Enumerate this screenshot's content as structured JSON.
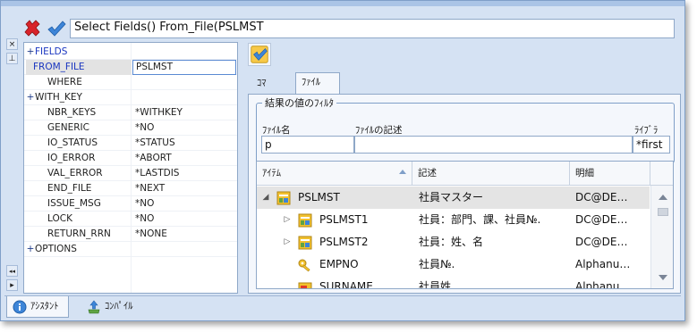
{
  "command": {
    "expression": "Select Fields() From_File(PSLMST"
  },
  "side_strip": {
    "close_glyph": "×",
    "pin_glyph": "⊥",
    "collapse_glyph": "◂◂",
    "expand_glyph": "▸"
  },
  "properties": [
    {
      "expander": "+",
      "name": "FIELDS",
      "value": "",
      "style": "blue"
    },
    {
      "expander": "+",
      "name": "FROM_FILE",
      "value": "PSLMST",
      "style": "blue-selected"
    },
    {
      "expander": "",
      "name": "WHERE",
      "value": "",
      "style": ""
    },
    {
      "expander": "+",
      "name": "WITH_KEY",
      "value": "",
      "style": ""
    },
    {
      "expander": "",
      "name": "NBR_KEYS",
      "value": "*WITHKEY",
      "style": ""
    },
    {
      "expander": "",
      "name": "GENERIC",
      "value": "*NO",
      "style": ""
    },
    {
      "expander": "",
      "name": "IO_STATUS",
      "value": "*STATUS",
      "style": ""
    },
    {
      "expander": "",
      "name": "IO_ERROR",
      "value": "*ABORT",
      "style": ""
    },
    {
      "expander": "",
      "name": "VAL_ERROR",
      "value": "*LASTDIS",
      "style": ""
    },
    {
      "expander": "",
      "name": "END_FILE",
      "value": "*NEXT",
      "style": ""
    },
    {
      "expander": "",
      "name": "ISSUE_MSG",
      "value": "*NO",
      "style": ""
    },
    {
      "expander": "",
      "name": "LOCK",
      "value": "*NO",
      "style": ""
    },
    {
      "expander": "",
      "name": "RETURN_RRN",
      "value": "*NONE",
      "style": ""
    },
    {
      "expander": "+",
      "name": "OPTIONS",
      "value": "",
      "style": ""
    }
  ],
  "tabs": {
    "command": "ｺﾏﾝﾄﾞ",
    "file": "ﾌｧｲﾙ"
  },
  "filter": {
    "title": "結果の値のﾌｨﾙﾀ",
    "file_name_label": "ﾌｧｲﾙ名",
    "file_desc_label": "ﾌｧｲﾙの記述",
    "library_label": "ﾗｲﾌﾞﾗ",
    "file_name_value": "p",
    "file_desc_value": "",
    "library_value": "*first"
  },
  "grid": {
    "columns": {
      "item": "ｱｲﾃﾑ",
      "desc": "記述",
      "detail": "明細"
    },
    "rows": [
      {
        "tri": "◢",
        "icon": "file-icon",
        "name": "PSLMST",
        "desc": "社員マスター",
        "detail": "DC@DE…",
        "level": 0,
        "selected": true
      },
      {
        "tri": "▷",
        "icon": "file-icon",
        "name": "PSLMST1",
        "desc": "社員：部門、課、社員№.",
        "detail": "DC@DE…",
        "level": 1,
        "selected": false
      },
      {
        "tri": "▷",
        "icon": "file-icon",
        "name": "PSLMST2",
        "desc": "社員：姓、名",
        "detail": "DC@DE…",
        "level": 1,
        "selected": false
      },
      {
        "tri": "",
        "icon": "key-icon",
        "name": "EMPNO",
        "desc": "社員№.",
        "detail": "Alphanu…",
        "level": 1,
        "selected": false
      },
      {
        "tri": "",
        "icon": "field-icon",
        "name": "SURNAME",
        "desc": "社員姓",
        "detail": "Alphanu…",
        "level": 1,
        "selected": false
      }
    ]
  },
  "bottom_tabs": {
    "assistant": "ｱｼｽﾀﾝﾄ",
    "compile": "ｺﾝﾊﾟｲﾙ"
  },
  "colors": {
    "window_bg": "#d5e2f3",
    "selection_bg": "#e4e4e4",
    "property_blue": "#1a36c0"
  }
}
